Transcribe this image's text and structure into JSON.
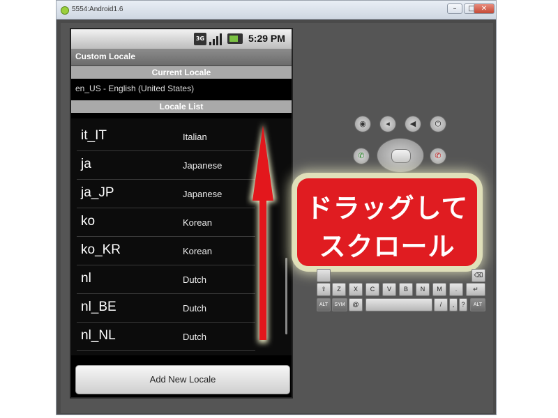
{
  "window": {
    "title": "5554:Android1.6",
    "min_glyph": "–",
    "max_glyph": "□",
    "close_glyph": "✕"
  },
  "status_bar": {
    "network": "3G",
    "time": "5:29 PM",
    "battery_color": "#7ac143"
  },
  "app": {
    "title": "Custom Locale",
    "current_locale_header": "Current Locale",
    "current_locale_value": "en_US - English (United States)",
    "locale_list_header": "Locale List",
    "locales": [
      {
        "code": "it_IT",
        "name": "Italian"
      },
      {
        "code": "ja",
        "name": "Japanese"
      },
      {
        "code": "ja_JP",
        "name": "Japanese"
      },
      {
        "code": "ko",
        "name": "Korean"
      },
      {
        "code": "ko_KR",
        "name": "Korean"
      },
      {
        "code": "nl",
        "name": "Dutch"
      },
      {
        "code": "nl_BE",
        "name": "Dutch"
      },
      {
        "code": "nl_NL",
        "name": "Dutch"
      }
    ],
    "add_button_label": "Add New Locale"
  },
  "callout": {
    "line1": "ドラッグして",
    "line2": "スクロール",
    "color": "#e01c21"
  },
  "keyboard": {
    "row_z": [
      "Z",
      "X",
      "C",
      "V",
      "B",
      "N",
      "M",
      "."
    ],
    "alt_label": "ALT",
    "sym_label": "SYM",
    "at_label": "@",
    "slash_label": "/",
    "question_label": "?",
    "comma_label": ",",
    "shift_glyph": "⇧",
    "enter_glyph": "↵",
    "del_glyph": "⌫"
  }
}
